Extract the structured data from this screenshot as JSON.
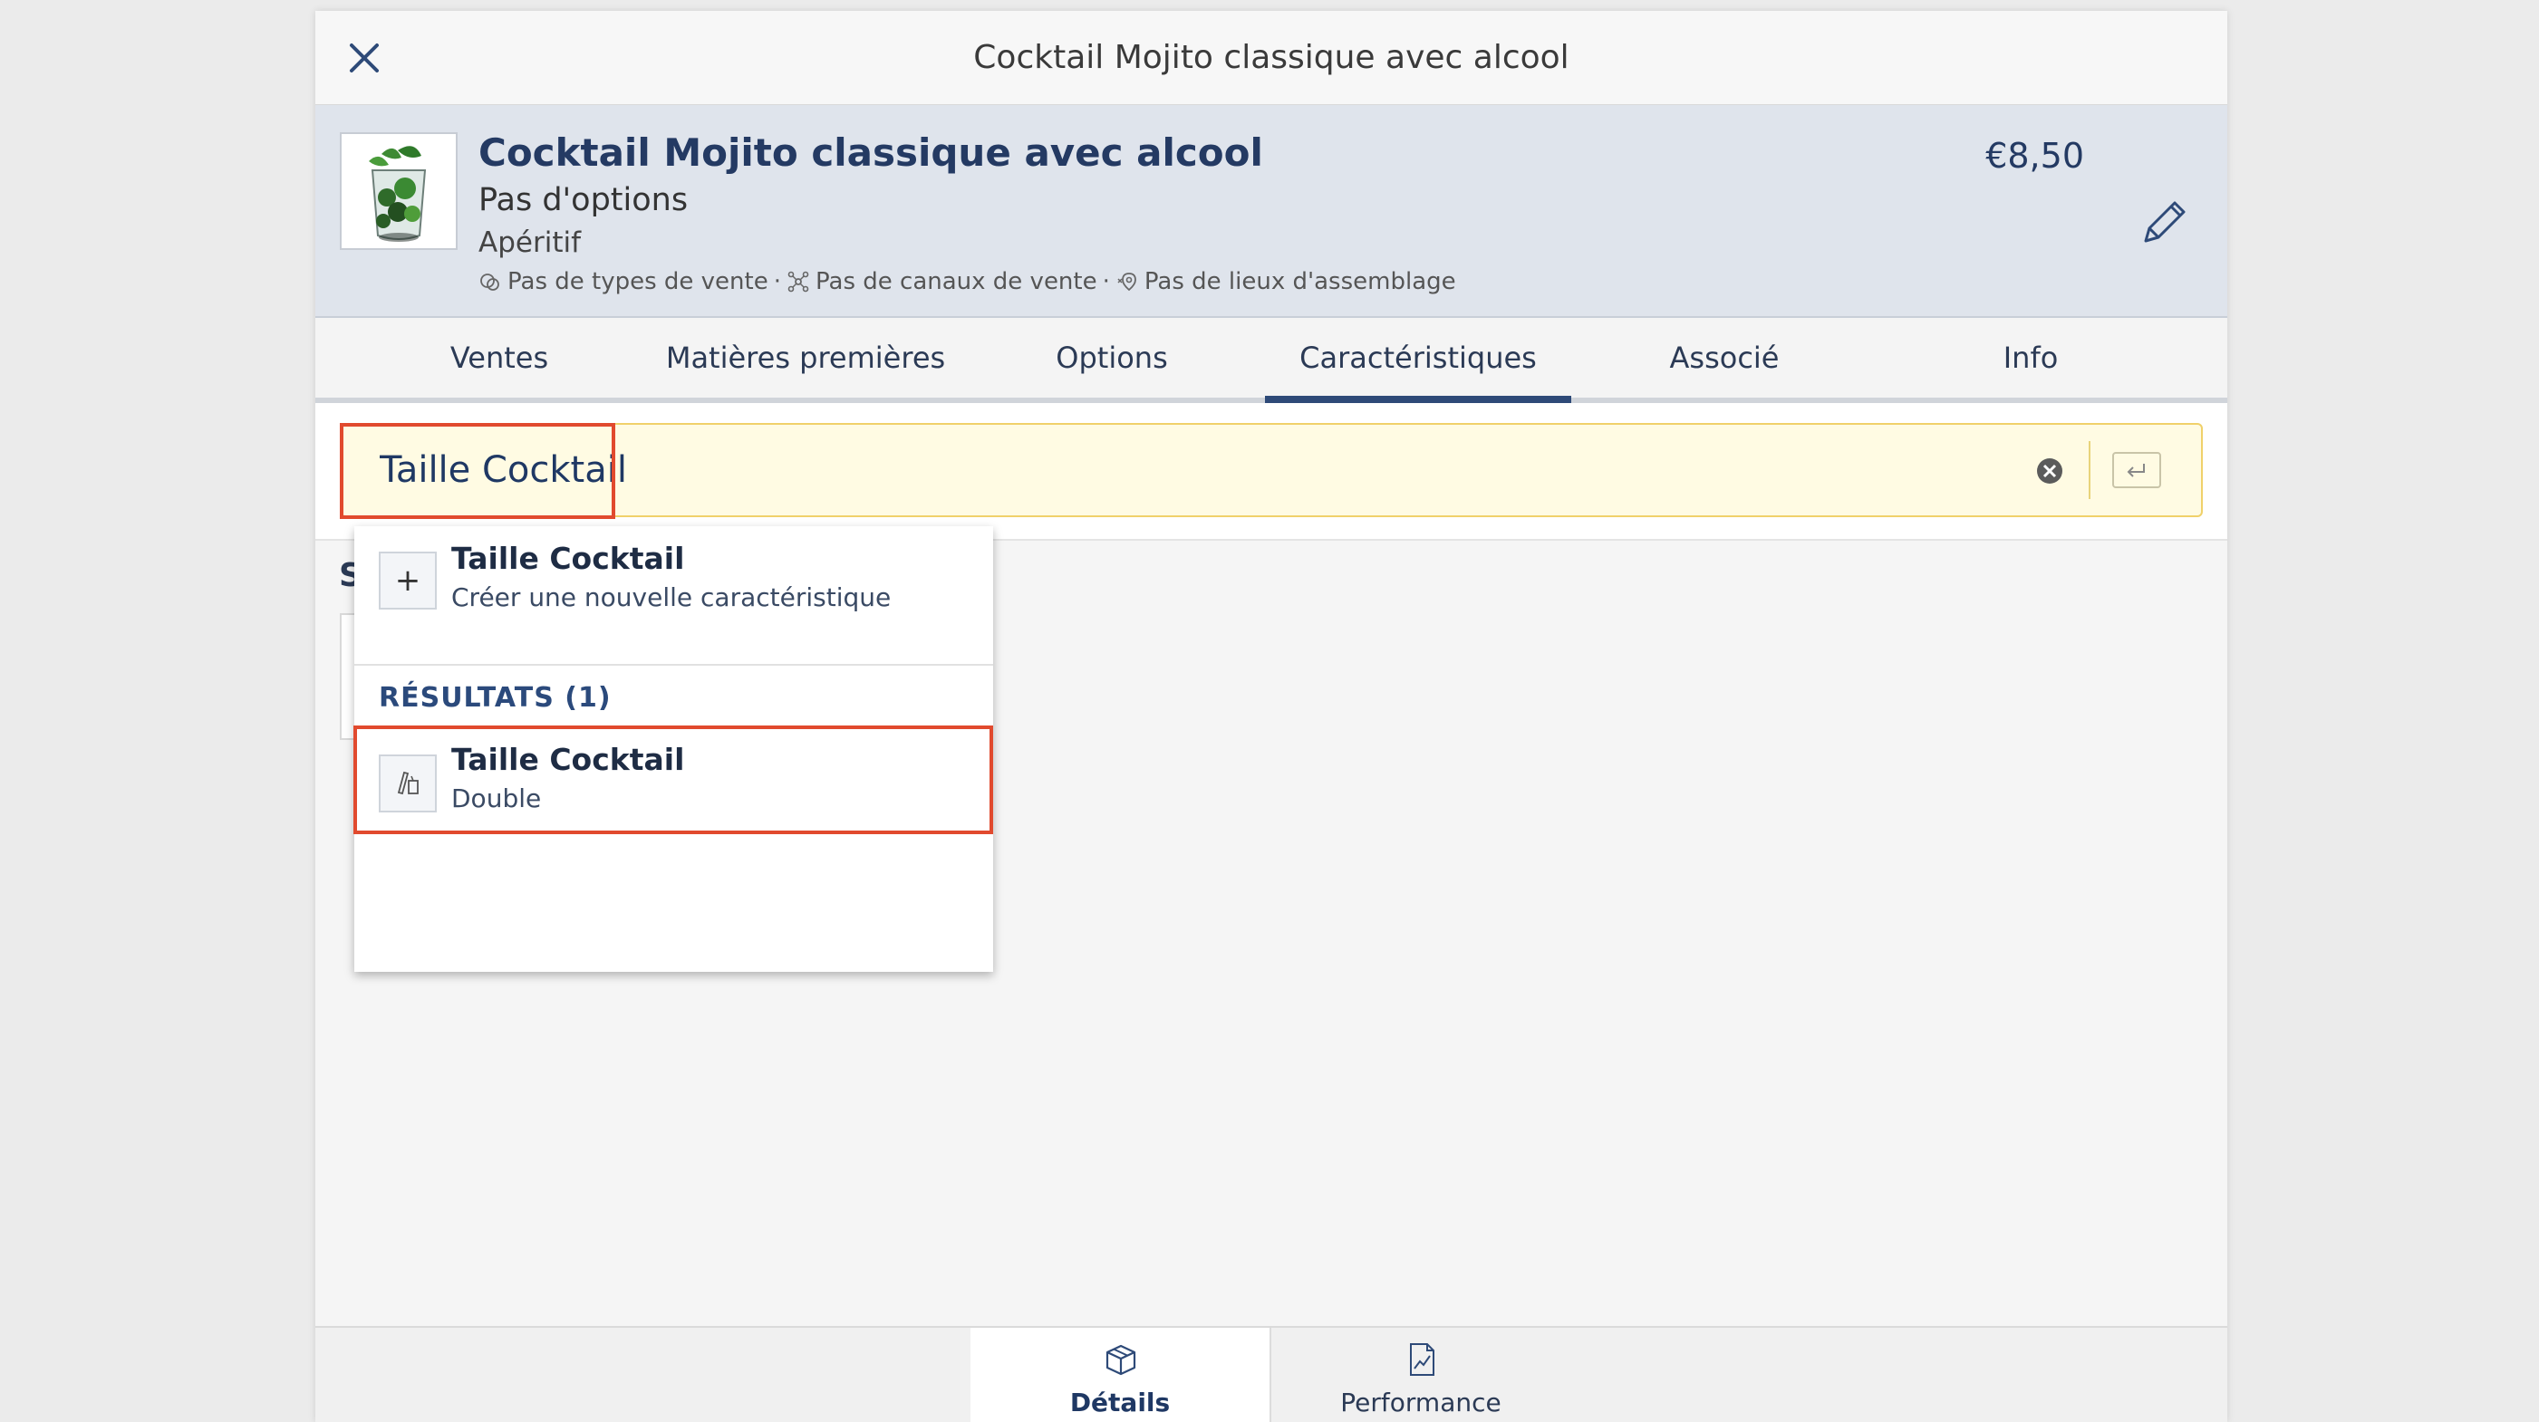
{
  "modal": {
    "title": "Cocktail Mojito classique avec alcool"
  },
  "product": {
    "name": "Cocktail Mojito classique avec alcool",
    "options": "Pas d'options",
    "category": "Apéritif",
    "meta": {
      "sale_types": "Pas de types de vente",
      "sale_channels": "Pas de canaux de vente",
      "assembly_places": "Pas de lieux d'assemblage",
      "separator": "·"
    },
    "price": "€8,50",
    "image_icon": "mojito-thumbnail"
  },
  "tabs": [
    {
      "label": "Ventes"
    },
    {
      "label": "Matières premières"
    },
    {
      "label": "Options"
    },
    {
      "label": "Caractéristiques",
      "active": true
    },
    {
      "label": "Associé"
    },
    {
      "label": "Info"
    }
  ],
  "search": {
    "value": "Taille Cocktail",
    "placeholder": ""
  },
  "section": {
    "label": "S"
  },
  "dropdown": {
    "create": {
      "icon": "+",
      "title": "Taille Cocktail",
      "subtitle": "Créer une nouvelle caractéristique"
    },
    "results_header": "RÉSULTATS (1)",
    "results": [
      {
        "title": "Taille Cocktail",
        "subtitle": "Double",
        "icon": "bottle-glass-icon"
      }
    ]
  },
  "bottom_nav": [
    {
      "label": "Détails",
      "icon": "box-icon",
      "active": true
    },
    {
      "label": "Performance",
      "icon": "chart-document-icon"
    }
  ],
  "colors": {
    "accent": "#2e4a78",
    "highlight": "#e14a2e",
    "search_bg": "#fffbe3",
    "header_bg": "#dfe4ec"
  }
}
